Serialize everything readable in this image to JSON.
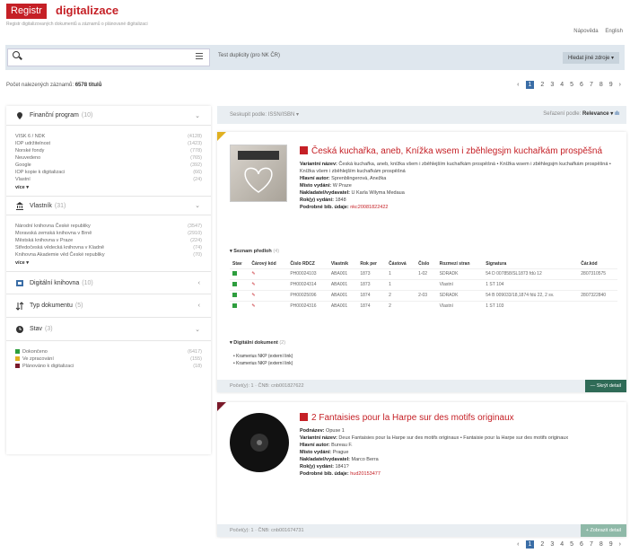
{
  "header": {
    "logo_box": "Registr",
    "logo_text": "digitalizace",
    "tagline": "Registr digitalizovaných dokumentů a záznamů o plánované digitalizaci",
    "links": [
      "Nápověda",
      "English"
    ]
  },
  "search": {
    "placeholder": "",
    "duplicity_link": "Test duplicity (pro NK ČR)",
    "other_search": "Hledat jiné zdroje ▾"
  },
  "results_count": {
    "label": "Počet nalezených záznamů:",
    "value": "6578 titulů"
  },
  "pagination": {
    "pages": [
      "1",
      "2",
      "3",
      "4",
      "5",
      "6",
      "7",
      "8",
      "9"
    ],
    "active": "1"
  },
  "facets": [
    {
      "title": "Finanční program",
      "count": "(10)",
      "chev": "⌄",
      "rows": [
        [
          "VISK 6 / NDK",
          "(4128)"
        ],
        [
          "IOP udržitelnost",
          "(1423)"
        ],
        [
          "Norské fondy",
          "(778)"
        ],
        [
          "Neuvedeno",
          "(765)"
        ],
        [
          "Google",
          "(392)"
        ],
        [
          "IOP kopie k digitalizaci",
          "(66)"
        ],
        [
          "Vlastní",
          "(24)"
        ]
      ],
      "more": "více ▾"
    },
    {
      "title": "Vlastník",
      "count": "(31)",
      "chev": "⌄",
      "rows": [
        [
          "Národní knihovna České republiky",
          "(3547)"
        ],
        [
          "Moravská zemská knihovna v Brně",
          "(2910)"
        ],
        [
          "Městská knihovna v Praze",
          "(224)"
        ],
        [
          "Středočeská vědecká knihovna v Kladně",
          "(74)"
        ],
        [
          "Knihovna Akademie věd České republiky",
          "(70)"
        ]
      ],
      "more": "více ▾"
    },
    {
      "title": "Digitální knihovna",
      "count": "(10)",
      "chev": "‹"
    },
    {
      "title": "Typ dokumentu",
      "count": "(5)",
      "chev": "‹"
    },
    {
      "title": "Stav",
      "count": "(3)",
      "chev": "⌄",
      "rows": [
        [
          "Dokončeno",
          "(6417)"
        ],
        [
          "Ve zpracování",
          "(155)"
        ],
        [
          "Plánováno k digitalizaci",
          "(18)"
        ]
      ]
    }
  ],
  "sort": {
    "left": "Seskupit podle: ISSN/ISBN ▾",
    "right_label": "Seřazení podle:",
    "right_value": "Relevance ▾"
  },
  "results": [
    {
      "title": "Česká kuchařka, aneb, Knížka wsem i zběhlegsjm kuchařkám prospěšná",
      "meta": [
        [
          "Variantní název:",
          "Česká kuchařka, aneb, knížka všem i zběhlejším kuchařkám prospěšná • Knížka wsem i zběhlegsjm kuchařkám prospěšná • Knížka všem i zběhlejším kuchařkám prospěšná"
        ],
        [
          "Hlavní autor:",
          "Sprenblingerová, Anežka"
        ],
        [
          "Místo vydání:",
          "W Praze"
        ],
        [
          "Nakladatel/vydavatel:",
          "U Karla Wilyma Medaua"
        ],
        [
          "Rok(y) vydání:",
          "1848"
        ],
        [
          "Podrobné bib. údaje:",
          "nkc20081822422"
        ]
      ],
      "items_label": "▾ Seznam předloh",
      "items_count": "(4)",
      "items_head": [
        "Stav",
        "Čárový kód",
        "Číslo RDCZ",
        "Vlastník",
        "Rok per",
        "Částová",
        "Číslo",
        "Rozmezí stran",
        "Signatura",
        "Čár.kód"
      ],
      "items": [
        [
          "",
          "",
          "PH00024103",
          "ABA001",
          "1873",
          "1",
          "1-02",
          "SDRADK",
          "54 D 007858/SL1873 fdú 12",
          "2807310575"
        ],
        [
          "",
          "",
          "PH00024314",
          "ABA001",
          "1873",
          "1",
          "",
          "Vlastní",
          "1 ST 104",
          ""
        ],
        [
          "",
          "",
          "PH00025096",
          "ABA001",
          "1874",
          "2",
          "2-03",
          "SDRADK",
          "54 B 009033/18,1874 fdú 22, 2 sv.",
          "2807322840"
        ],
        [
          "",
          "",
          "PH00024316",
          "ABA001",
          "1874",
          "2",
          "",
          "Vlastní",
          "1 ST 103",
          ""
        ]
      ],
      "digital_label": "▾ Digitální dokument",
      "digital_count": "(2)",
      "digital": [
        "Kramerius NKP (externí link)",
        "Kramerius NKP (externí link)"
      ],
      "foot": "Počet(y): 1 · ČNB: cnb001827622",
      "button": "— Skrýt detail"
    },
    {
      "title": "2 Fantaisies pour la Harpe sur des motifs originaux",
      "meta": [
        [
          "Podnázev:",
          "Opuse 1"
        ],
        [
          "Variantní název:",
          "Deux Fantaisies pour la Harpe sur des motifs originaux • Fantaisie pour la Harpe sur des motifs originaux"
        ],
        [
          "Hlavní autor:",
          "Bureau F."
        ],
        [
          "Místo vydání:",
          "Prague"
        ],
        [
          "Nakladatel/vydavatel:",
          "Marco Berra"
        ],
        [
          "Rok(y) vydání:",
          "1841?"
        ],
        [
          "Podrobné bib. údaje:",
          "hud20153477"
        ]
      ],
      "foot": "Počet(y): 1 · ČNB: cnb001674731",
      "button": "+ Zobrazit detail"
    }
  ]
}
